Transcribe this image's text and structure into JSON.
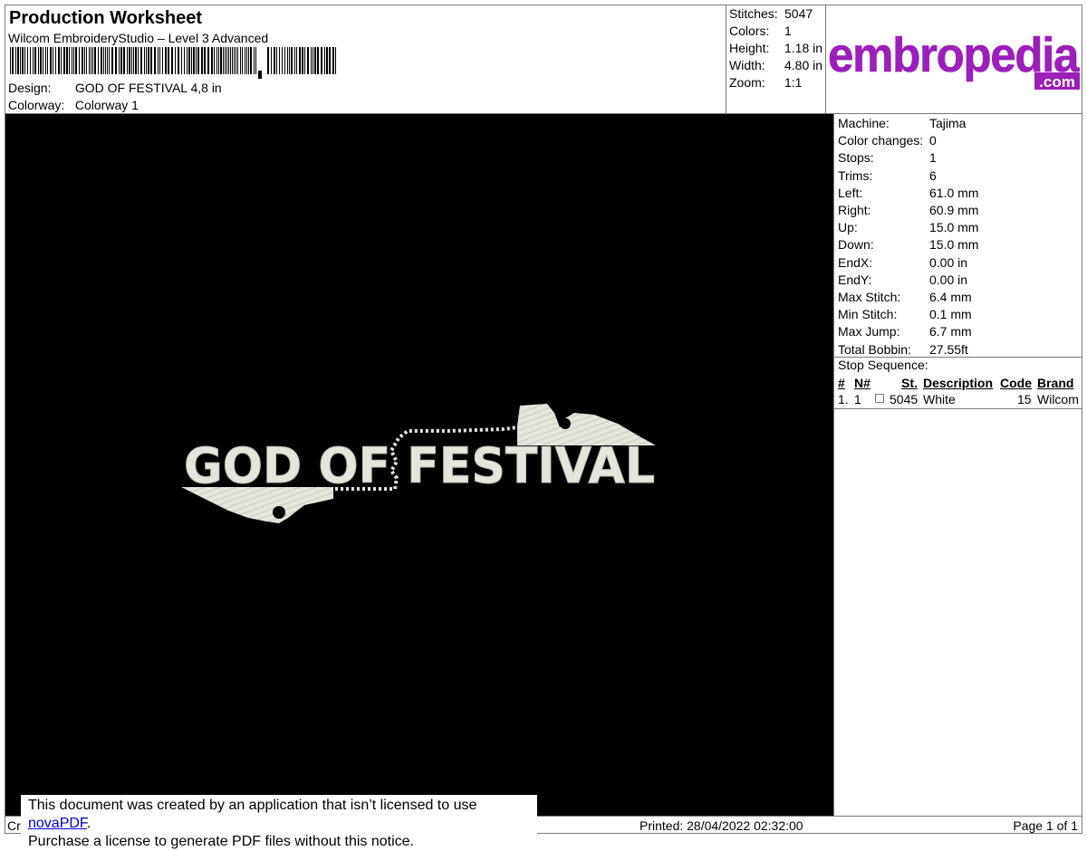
{
  "header": {
    "title": "Production Worksheet",
    "software": "Wilcom EmbroideryStudio – Level 3 Advanced",
    "design_label": "Design:",
    "design_value": "GOD OF FESTIVAL 4,8 in",
    "colorway_label": "Colorway:",
    "colorway_value": "Colorway 1"
  },
  "stats": {
    "stitches_label": "Stitches:",
    "stitches_value": "5047",
    "colors_label": "Colors:",
    "colors_value": "1",
    "height_label": "Height:",
    "height_value": "1.18 in",
    "width_label": "Width:",
    "width_value": "4.80 in",
    "zoom_label": "Zoom:",
    "zoom_value": "1:1"
  },
  "logo": {
    "main": "embropedia",
    "suffix": ".com",
    "color": "#9b1fb8"
  },
  "design_preview": {
    "text": "GOD OF FESTIVAL",
    "thread_color": "#e4e6dc",
    "background": "#000000"
  },
  "machine_info": [
    {
      "label": "Machine:",
      "value": "Tajima"
    },
    {
      "label": "Color changes:",
      "value": "0"
    },
    {
      "label": "Stops:",
      "value": "1"
    },
    {
      "label": "Trims:",
      "value": "6"
    },
    {
      "label": "Left:",
      "value": "61.0 mm"
    },
    {
      "label": "Right:",
      "value": "60.9 mm"
    },
    {
      "label": "Up:",
      "value": "15.0 mm"
    },
    {
      "label": "Down:",
      "value": "15.0 mm"
    },
    {
      "label": "EndX:",
      "value": "0.00 in"
    },
    {
      "label": "EndY:",
      "value": "0.00 in"
    },
    {
      "label": "Max Stitch:",
      "value": "6.4 mm"
    },
    {
      "label": "Min Stitch:",
      "value": "0.1 mm"
    },
    {
      "label": "Max Jump:",
      "value": "6.7 mm"
    },
    {
      "label": "Total Bobbin:",
      "value": "27.55ft"
    }
  ],
  "stop_sequence": {
    "title": "Stop Sequence:",
    "columns": {
      "num": "#",
      "n": "N#",
      "st": "St.",
      "desc": "Description",
      "code": "Code",
      "brand": "Brand"
    },
    "rows": [
      {
        "num": "1.",
        "n": "1",
        "st": "5045",
        "desc": "White",
        "code": "15",
        "brand": "Wilcom"
      }
    ]
  },
  "footer": {
    "left": "Cr",
    "printed": "Printed: 28/04/2022 02:32:00",
    "page": "Page 1 of 1"
  },
  "notice": {
    "line1_prefix": "This document was created by an application that isn’t licensed to use ",
    "link": "novaPDF",
    "line1_suffix": ".",
    "line2": "Purchase a license to generate PDF files without this notice."
  }
}
